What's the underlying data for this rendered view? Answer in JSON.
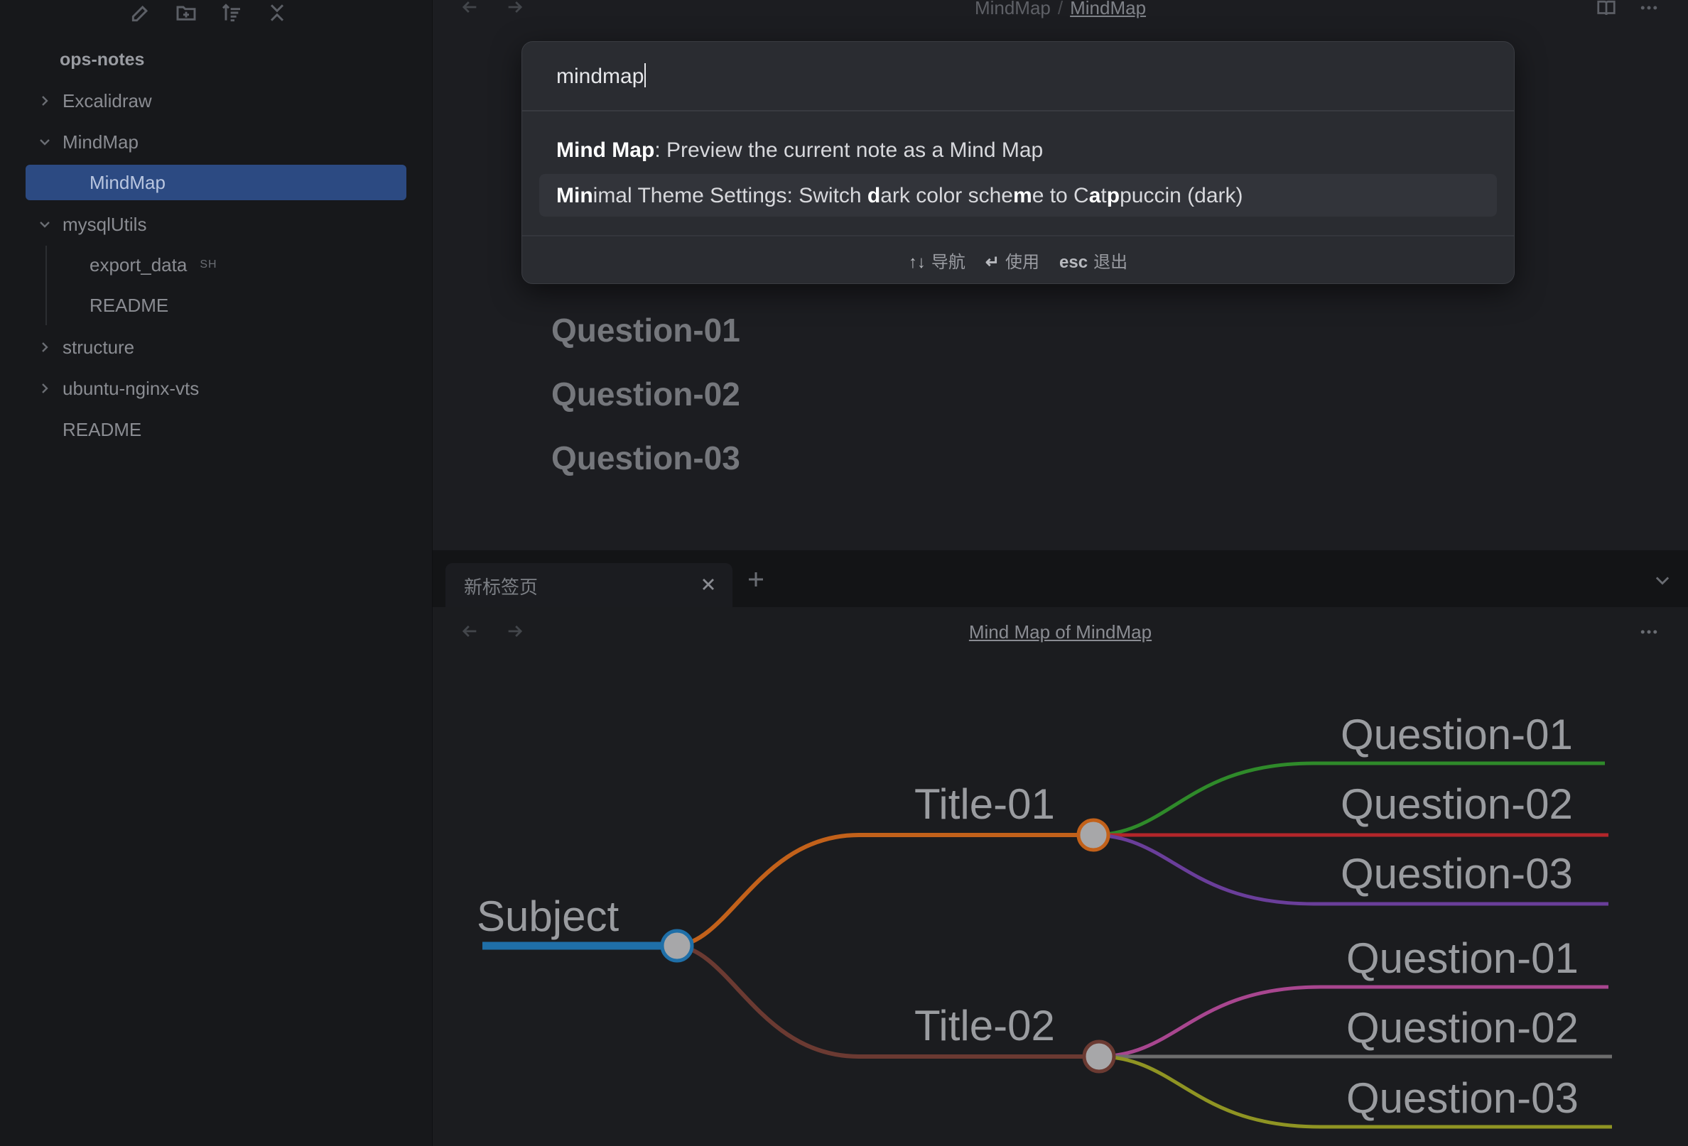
{
  "sidebar": {
    "toolbar_icons": [
      "new-note-icon",
      "new-folder-icon",
      "sort-icon",
      "collapse-all-icon"
    ],
    "vault_name": "ops-notes",
    "items": [
      {
        "label": "Excalidraw",
        "expanded": false
      },
      {
        "label": "MindMap",
        "expanded": true
      },
      {
        "label": "MindMap",
        "active": true
      },
      {
        "label": "mysqlUtils",
        "expanded": true
      },
      {
        "label": "export_data",
        "tag": "SH"
      },
      {
        "label": "README"
      },
      {
        "label": "structure",
        "expanded": false
      },
      {
        "label": "ubuntu-nginx-vts",
        "expanded": false
      },
      {
        "label": "README"
      }
    ]
  },
  "editor": {
    "breadcrumb_parent": "MindMap",
    "breadcrumb_sep": "/",
    "breadcrumb_current": "MindMap",
    "headings": [
      "Question-01",
      "Question-02",
      "Question-03"
    ]
  },
  "palette": {
    "query": "mindmap",
    "suggestions": [
      {
        "bold": "Mind Map",
        "rest": ": Preview the current note as a Mind Map"
      },
      {
        "html_parts": [
          [
            "b",
            "Min"
          ],
          [
            "t",
            "imal Theme Settings: Switch "
          ],
          [
            "b",
            "d"
          ],
          [
            "t",
            "ark color sche"
          ],
          [
            "b",
            "m"
          ],
          [
            "t",
            "e to C"
          ],
          [
            "b",
            "a"
          ],
          [
            "t",
            "t"
          ],
          [
            "b",
            "p"
          ],
          [
            "t",
            "puccin (dark)"
          ]
        ]
      }
    ],
    "footer": [
      {
        "key": "↑↓",
        "label": "导航"
      },
      {
        "key": "↵",
        "label": "使用"
      },
      {
        "key": "esc",
        "label": "退出"
      }
    ]
  },
  "bottom_pane": {
    "tab_label": "新标签页",
    "view_title": "Mind Map of MindMap"
  },
  "mindmap": {
    "root": "Subject",
    "branches": [
      {
        "title": "Title-01",
        "children": [
          "Question-01",
          "Question-02",
          "Question-03"
        ]
      },
      {
        "title": "Title-02",
        "children": [
          "Question-01",
          "Question-02",
          "Question-03"
        ]
      }
    ],
    "colors": {
      "root": "#1f6fa8",
      "title01": "#c2611a",
      "title02": "#6b3a32",
      "t1q1": "#2f8a2a",
      "t1q2": "#b3262a",
      "t1q3": "#6a3e9a",
      "t2q1": "#a8468f",
      "t2q2": "#6d6d6d",
      "t2q3": "#8f9423"
    }
  }
}
